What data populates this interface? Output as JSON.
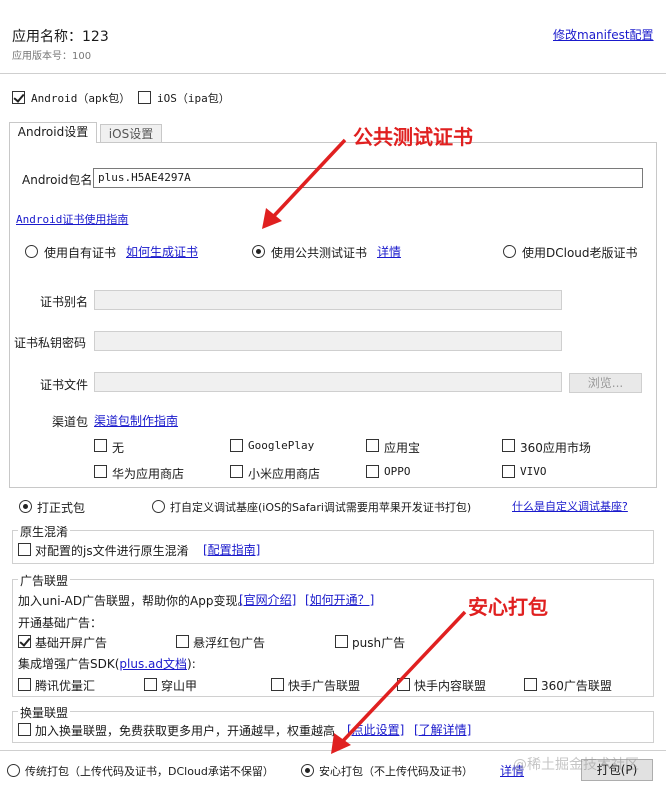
{
  "header": {
    "app_name": "应用名称：123",
    "app_version": "应用版本号：100",
    "modify_manifest_link": "修改manifest配置"
  },
  "platforms": {
    "android": {
      "label": "Android（apk包）",
      "checked": true
    },
    "ios": {
      "label": "iOS（ipa包）",
      "checked": false
    }
  },
  "tabs": [
    {
      "label": "Android设置",
      "active": true
    },
    {
      "label": "iOS设置",
      "active": false
    }
  ],
  "android": {
    "package_label": "Android包名",
    "package_value": "plus.H5AE4297A",
    "cert_guide_link": "Android证书使用指南",
    "cert_options": [
      {
        "label": "使用自有证书",
        "link": "如何生成证书",
        "checked": false
      },
      {
        "label": "使用公共测试证书",
        "link": "详情",
        "checked": true
      },
      {
        "label": "使用DCloud老版证书",
        "checked": false
      }
    ],
    "alias_label": "证书别名",
    "password_label": "证书私钥密码",
    "file_label": "证书文件",
    "browse_button": "浏览...",
    "channel_label": "渠道包",
    "channel_guide_link": "渠道包制作指南",
    "channels": [
      {
        "label": "无",
        "checked": false
      },
      {
        "label": "GooglePlay",
        "checked": false
      },
      {
        "label": "应用宝",
        "checked": false
      },
      {
        "label": "360应用市场",
        "checked": false
      },
      {
        "label": "华为应用商店",
        "checked": false
      },
      {
        "label": "小米应用商店",
        "checked": false
      },
      {
        "label": "OPPO",
        "checked": false
      },
      {
        "label": "VIVO",
        "checked": false
      }
    ]
  },
  "build_type": {
    "formal": {
      "label": "打正式包",
      "checked": true
    },
    "custom": {
      "label": "打自定义调试基座(iOS的Safari调试需要用苹果开发证书打包)",
      "checked": false
    },
    "custom_link": "什么是自定义调试基座?"
  },
  "obfuscation": {
    "title": "原生混淆",
    "checkbox_label": "对配置的js文件进行原生混淆",
    "guide_link": "[配置指南]",
    "checked": false
  },
  "ads": {
    "title": "广告联盟",
    "description": "加入uni-AD广告联盟，帮助你的App变现。",
    "intro_link": "[官网介绍]",
    "how_link": "[如何开通？]",
    "basic_title": "开通基础广告：",
    "basic": [
      {
        "label": "基础开屏广告",
        "checked": true
      },
      {
        "label": "悬浮红包广告",
        "checked": false
      },
      {
        "label": "push广告",
        "checked": false
      }
    ],
    "sdk_title_prefix": "集成增强广告SDK(",
    "sdk_link": "plus.ad文档",
    "sdk_title_suffix": "):",
    "sdk": [
      {
        "label": "腾讯优量汇",
        "checked": false
      },
      {
        "label": "穿山甲",
        "checked": false
      },
      {
        "label": "快手广告联盟",
        "checked": false
      },
      {
        "label": "快手内容联盟",
        "checked": false
      },
      {
        "label": "360广告联盟",
        "checked": false
      }
    ]
  },
  "exchange": {
    "title": "换量联盟",
    "checkbox_label": "加入换量联盟，免费获取更多用户，开通越早，权重越高",
    "settings_link": "[点此设置]",
    "details_link": "[了解详情]",
    "checked": false
  },
  "footer": {
    "traditional": {
      "label": "传统打包（上传代码及证书，DCloud承诺不保留）",
      "checked": false
    },
    "safe": {
      "label": "安心打包（不上传代码及证书）",
      "checked": true
    },
    "details_link": "详情",
    "pack_button": "打包(P)"
  },
  "annotations": {
    "public_cert": "公共测试证书",
    "safe_pack": "安心打包",
    "watermark": "@稀土掘金技术社区",
    "color": "#e02020"
  }
}
